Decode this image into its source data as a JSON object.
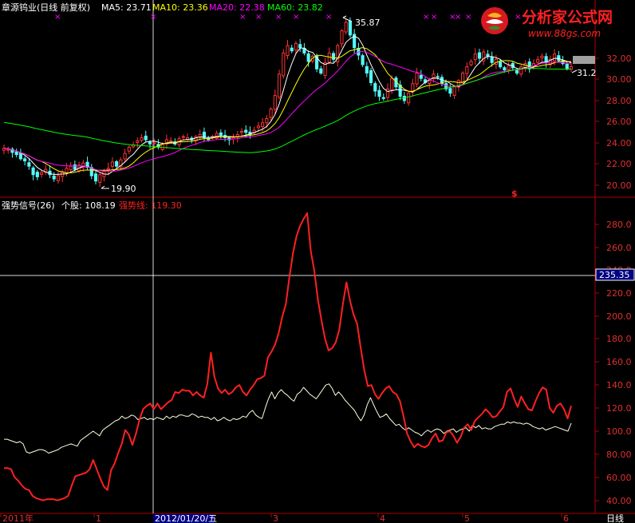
{
  "colors": {
    "background": "#000000",
    "up": "#ff3232",
    "down": "#54fcfc",
    "axis": "#b00000",
    "ma5": "#ffffff",
    "ma10": "#ffff00",
    "ma20": "#ff00ff",
    "ma60": "#00ff00",
    "strong": "#ff2020",
    "stock": "#ffffe0"
  },
  "header": {
    "stock": "章源钨业(日线 前复权)",
    "ma5": "MA5: 23.71",
    "ma10": "MA10: 23.36",
    "ma20": "MA20: 22.38",
    "ma60": "MA60: 23.82"
  },
  "watermark": {
    "site_name": "分析家公式网",
    "url": "www.88gs.com"
  },
  "price_panel": {
    "high_label": "35.87",
    "low_label": "19.90",
    "last_label": "31.2",
    "signal_mark": "$",
    "y_ticks": [
      "32.00",
      "30.00",
      "28.00",
      "26.00",
      "24.00",
      "22.00",
      "20.00"
    ]
  },
  "indicator_panel": {
    "title": "强势信号(26)",
    "stock_value": "个股: 108.19",
    "strong_value": "强势线: 119.30",
    "crosshair_value": "235.35",
    "y_ticks": [
      "280.0",
      "260.0",
      "240.0",
      "220.0",
      "200.0",
      "180.0",
      "160.0",
      "140.0",
      "120.0",
      "100.0",
      "80.00",
      "60.00",
      "40.00"
    ]
  },
  "x_axis": {
    "labels": [
      "2011年",
      "1",
      "2012/01/20/五",
      "3",
      "4",
      "5",
      "6"
    ],
    "period": "日线"
  },
  "chart_data": [
    {
      "type": "candlestick",
      "title": "章源钨业(日线 前复权)",
      "ylim": [
        19,
        34
      ],
      "annotations": [
        {
          "label": "35.87",
          "kind": "high"
        },
        {
          "label": "19.90",
          "kind": "low"
        },
        {
          "label": "31.2",
          "kind": "last"
        }
      ],
      "close": [
        23.5,
        23.4,
        23.1,
        22.9,
        22.5,
        22.3,
        21.8,
        21.0,
        20.8,
        21.2,
        21.5,
        21.0,
        20.6,
        20.9,
        21.3,
        21.6,
        21.8,
        21.5,
        21.9,
        22.1,
        21.7,
        20.9,
        20.4,
        21.0,
        21.3,
        21.6,
        22.2,
        21.8,
        22.4,
        23.0,
        23.6,
        23.8,
        24.2,
        24.5,
        24.3,
        23.9,
        24.0,
        23.6,
        23.9,
        24.3,
        24.2,
        23.9,
        24.4,
        24.6,
        24.5,
        24.3,
        24.6,
        24.8,
        24.5,
        24.3,
        24.6,
        24.9,
        24.7,
        24.5,
        24.3,
        24.5,
        24.8,
        25.1,
        25.0,
        24.8,
        25.2,
        25.6,
        25.9,
        26.3,
        27.2,
        28.5,
        30.5,
        32.5,
        33.2,
        32.7,
        33.4,
        33.0,
        32.5,
        31.7,
        32.2,
        31.0,
        30.6,
        31.6,
        32.5,
        31.9,
        33.2,
        34.6,
        35.4,
        34.2,
        33.0,
        32.3,
        31.4,
        30.6,
        29.7,
        28.9,
        28.4,
        28.2,
        29.1,
        30.1,
        29.3,
        28.4,
        28.0,
        28.7,
        29.6,
        30.6,
        30.1,
        29.7,
        29.9,
        30.5,
        30.2,
        29.6,
        29.1,
        28.7,
        29.3,
        29.9,
        30.6,
        31.2,
        31.7,
        32.4,
        32.0,
        32.6,
        32.2,
        31.6,
        31.9,
        31.2,
        30.9,
        31.3,
        31.1,
        30.6,
        31.2,
        31.5,
        31.0,
        31.5,
        31.9,
        32.2,
        31.6,
        31.9,
        32.4,
        31.8,
        31.5,
        31.0,
        31.2
      ]
    },
    {
      "type": "line",
      "title": "强势信号(26)",
      "ylim": [
        35,
        295
      ],
      "series": [
        {
          "name": "个股",
          "values": [
            93,
            93,
            92,
            91,
            90,
            91,
            89,
            82,
            81,
            82,
            83,
            84,
            84,
            83,
            81,
            82,
            83,
            84,
            86,
            87,
            88,
            89,
            88,
            87,
            92,
            94,
            96,
            98,
            100,
            98,
            96,
            101,
            103,
            105,
            107,
            109,
            110,
            113,
            111,
            112,
            114,
            113,
            110,
            111,
            112,
            110,
            111,
            110,
            112,
            111,
            110,
            113,
            111,
            113,
            112,
            114,
            114,
            113,
            113,
            115,
            114,
            112,
            113,
            112,
            112,
            110,
            112,
            109,
            110,
            112,
            110,
            109,
            111,
            110,
            111,
            113,
            112,
            116,
            118,
            114,
            112,
            111,
            120,
            128,
            134,
            128,
            133,
            136,
            133,
            131,
            128,
            126,
            132,
            134,
            138,
            135,
            132,
            130,
            128,
            132,
            136,
            140,
            141,
            137,
            131,
            134,
            131,
            127,
            124,
            121,
            118,
            113,
            109,
            114,
            123,
            129,
            123,
            117,
            112,
            113,
            115,
            111,
            108,
            105,
            106,
            103,
            101,
            103,
            101,
            99,
            98,
            96,
            99,
            101,
            99,
            101,
            102,
            101,
            98,
            100,
            101,
            102,
            99,
            101,
            102,
            103,
            100,
            105,
            103,
            105,
            102,
            103,
            102,
            102,
            104,
            105,
            106,
            106,
            108,
            107,
            108,
            107,
            107,
            106,
            107,
            106,
            104,
            103,
            102,
            103,
            101,
            102,
            103,
            104,
            103,
            102,
            101,
            100,
            107
          ]
        },
        {
          "name": "强势线",
          "values": [
            68,
            68,
            67,
            60,
            57,
            53,
            50,
            49,
            44,
            42,
            41,
            40,
            41,
            41,
            41,
            40,
            41,
            42,
            44,
            53,
            61,
            62,
            63,
            64,
            67,
            75,
            67,
            59,
            52,
            49,
            66,
            72,
            81,
            89,
            101,
            97,
            88,
            98,
            110,
            119,
            122,
            124,
            119,
            124,
            119,
            122,
            125,
            127,
            134,
            133,
            136,
            135,
            135,
            131,
            134,
            131,
            129,
            141,
            168,
            147,
            137,
            133,
            136,
            132,
            134,
            138,
            140,
            134,
            131,
            136,
            140,
            145,
            146,
            148,
            164,
            169,
            175,
            185,
            199,
            210,
            233,
            254,
            269,
            278,
            284,
            289,
            256,
            239,
            214,
            196,
            180,
            170,
            172,
            177,
            188,
            210,
            229,
            213,
            201,
            193,
            172,
            153,
            139,
            140,
            132,
            128,
            133,
            137,
            139,
            134,
            132,
            126,
            113,
            98,
            91,
            86,
            89,
            87,
            86,
            88,
            94,
            98,
            91,
            92,
            99,
            100,
            96,
            90,
            95,
            103,
            106,
            101,
            109,
            112,
            115,
            119,
            116,
            112,
            113,
            117,
            121,
            134,
            137,
            128,
            121,
            130,
            124,
            119,
            118,
            126,
            133,
            138,
            136,
            120,
            116,
            122,
            124,
            119,
            111,
            122
          ]
        }
      ]
    }
  ]
}
